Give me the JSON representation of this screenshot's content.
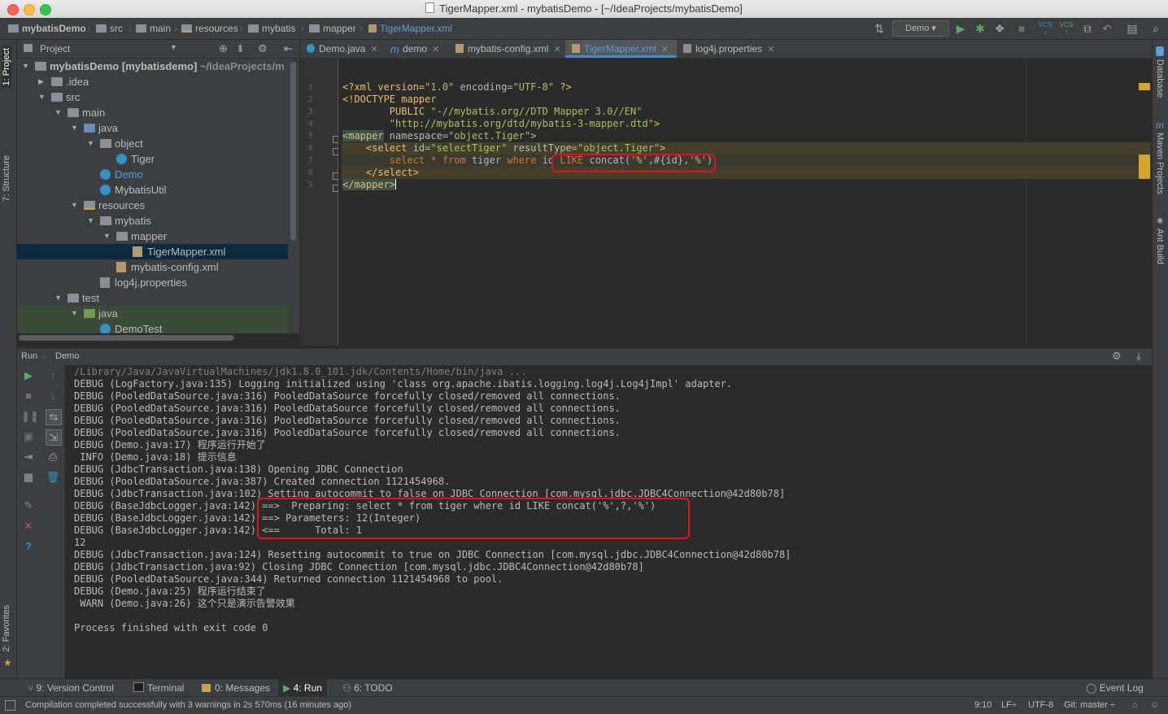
{
  "window": {
    "title": "TigerMapper.xml - mybatisDemo - [~/IdeaProjects/mybatisDemo]"
  },
  "breadcrumbs": [
    "mybatisDemo",
    "src",
    "main",
    "resources",
    "mybatis",
    "mapper",
    "TigerMapper.xml"
  ],
  "toolbar": {
    "run_config": "Demo",
    "vcs_label_1": "VCS",
    "vcs_label_2": "VCS"
  },
  "project_panel": {
    "title": "Project",
    "tree": [
      {
        "label": "mybatisDemo [mybatisdemo]",
        "suffix": "~/IdeaProjects/m",
        "depth": 0,
        "icon": "folder",
        "arrow": "down"
      },
      {
        "label": ".idea",
        "depth": 1,
        "icon": "folder",
        "arrow": "right"
      },
      {
        "label": "src",
        "depth": 1,
        "icon": "folder",
        "arrow": "down"
      },
      {
        "label": "main",
        "depth": 2,
        "icon": "folder",
        "arrow": "down"
      },
      {
        "label": "java",
        "depth": 3,
        "icon": "src",
        "arrow": "down"
      },
      {
        "label": "object",
        "depth": 4,
        "icon": "folder",
        "arrow": "down"
      },
      {
        "label": "Tiger",
        "depth": 5,
        "icon": "class",
        "arrow": ""
      },
      {
        "label": "Demo",
        "depth": 4,
        "icon": "class",
        "arrow": "",
        "color": "#5e9ed6"
      },
      {
        "label": "MybatisUtil",
        "depth": 4,
        "icon": "class",
        "arrow": ""
      },
      {
        "label": "resources",
        "depth": 3,
        "icon": "res",
        "arrow": "down"
      },
      {
        "label": "mybatis",
        "depth": 4,
        "icon": "folder",
        "arrow": "down"
      },
      {
        "label": "mapper",
        "depth": 5,
        "icon": "folder",
        "arrow": "down"
      },
      {
        "label": "TigerMapper.xml",
        "depth": 6,
        "icon": "xml",
        "arrow": "",
        "selected": true
      },
      {
        "label": "mybatis-config.xml",
        "depth": 5,
        "icon": "xml",
        "arrow": ""
      },
      {
        "label": "log4j.properties",
        "depth": 4,
        "icon": "prop",
        "arrow": ""
      },
      {
        "label": "test",
        "depth": 2,
        "icon": "folder",
        "arrow": "down"
      },
      {
        "label": "java",
        "depth": 3,
        "icon": "tst",
        "arrow": "down",
        "test": true
      },
      {
        "label": "DemoTest",
        "depth": 4,
        "icon": "class",
        "arrow": "",
        "test": true
      }
    ]
  },
  "editor_tabs": [
    {
      "label": "Demo.java",
      "active": false,
      "icon": "class"
    },
    {
      "label": "demo",
      "active": false,
      "icon": "m"
    },
    {
      "label": "mybatis-config.xml",
      "active": false,
      "icon": "xml"
    },
    {
      "label": "TigerMapper.xml",
      "active": true,
      "icon": "xml"
    },
    {
      "label": "log4j.properties",
      "active": false,
      "icon": "prop"
    }
  ],
  "editor_lines": [
    "1",
    "2",
    "3",
    "4",
    "5",
    "6",
    "7",
    "8",
    "9"
  ],
  "code": {
    "l1_a": "<?xml version=",
    "l1_b": "\"1.0\"",
    "l1_c": " encoding=",
    "l1_d": "\"UTF-8\"",
    "l1_e": " ?>",
    "l2": "<!DOCTYPE mapper",
    "l3_a": "        PUBLIC ",
    "l3_b": "\"-//mybatis.org//DTD Mapper 3.0//EN\"",
    "l4_a": "        ",
    "l4_b": "\"http://mybatis.org/dtd/mybatis-3-mapper.dtd\"",
    "l4_c": ">",
    "l5_a": "<mapper",
    "l5_b": " namespace=",
    "l5_c": "\"object.Tiger\"",
    "l5_d": ">",
    "l6_a": "    <select",
    "l6_b": " id=",
    "l6_c": "\"selectTiger\"",
    "l6_d": " resultType=",
    "l6_e": "\"object.Tiger\"",
    "l6_f": ">",
    "l7_a": "        select * from ",
    "l7_b": "tiger ",
    "l7_c": "where ",
    "l7_d": "id ",
    "l7_e": "LIKE ",
    "l7_f": "concat(",
    "l7_g": "'%'",
    "l7_h": ",#{id},",
    "l7_i": "'%'",
    "l7_j": ")",
    "l8": "    </select>",
    "l9": "</mapper>"
  },
  "run_panel": {
    "title": "Run",
    "config": "Demo"
  },
  "console": [
    "/Library/Java/JavaVirtualMachines/jdk1.8.0_101.jdk/Contents/Home/bin/java ...",
    "DEBUG (LogFactory.java:135) Logging initialized using 'class org.apache.ibatis.logging.log4j.Log4jImpl' adapter.",
    "DEBUG (PooledDataSource.java:316) PooledDataSource forcefully closed/removed all connections.",
    "DEBUG (PooledDataSource.java:316) PooledDataSource forcefully closed/removed all connections.",
    "DEBUG (PooledDataSource.java:316) PooledDataSource forcefully closed/removed all connections.",
    "DEBUG (PooledDataSource.java:316) PooledDataSource forcefully closed/removed all connections.",
    "DEBUG (Demo.java:17) 程序运行开始了",
    " INFO (Demo.java:18) 提示信息",
    "DEBUG (JdbcTransaction.java:138) Opening JDBC Connection",
    "DEBUG (PooledDataSource.java:387) Created connection 1121454968.",
    "DEBUG (JdbcTransaction.java:102) Setting autocommit to false on JDBC Connection [com.mysql.jdbc.JDBC4Connection@42d80b78]",
    "DEBUG (BaseJdbcLogger.java:142) ==>  Preparing: select * from tiger where id LIKE concat('%',?,'%')",
    "DEBUG (BaseJdbcLogger.java:142) ==> Parameters: 12(Integer)",
    "DEBUG (BaseJdbcLogger.java:142) <==      Total: 1",
    "12",
    "DEBUG (JdbcTransaction.java:124) Resetting autocommit to true on JDBC Connection [com.mysql.jdbc.JDBC4Connection@42d80b78]",
    "DEBUG (JdbcTransaction.java:92) Closing JDBC Connection [com.mysql.jdbc.JDBC4Connection@42d80b78]",
    "DEBUG (PooledDataSource.java:344) Returned connection 1121454968 to pool.",
    "DEBUG (Demo.java:25) 程序运行结束了",
    " WARN (Demo.java:26) 这个只是演示告警效果",
    "",
    "Process finished with exit code 0"
  ],
  "left_stripe": {
    "project": "1: Project",
    "structure": "7: Structure",
    "favorites": "2: Favorites"
  },
  "right_stripe": {
    "database": "Database",
    "maven": "Maven Projects",
    "ant": "Ant Build"
  },
  "bottom_tools": {
    "version_control": "9: Version Control",
    "terminal": "Terminal",
    "messages": "0: Messages",
    "run": "4: Run",
    "todo": "6: TODO",
    "event_log": "Event Log"
  },
  "status": {
    "message": "Compilation completed successfully with 3 warnings in 2s 570ms (16 minutes ago)",
    "position": "9:10",
    "line_sep": "LF÷",
    "encoding": "UTF-8",
    "git": "Git: master ÷"
  }
}
